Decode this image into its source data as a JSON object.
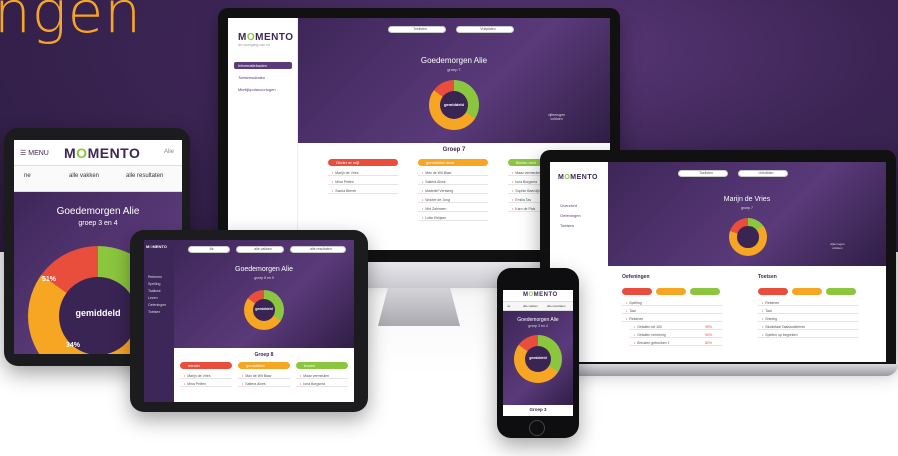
{
  "headline": "ngen",
  "brand": {
    "name_prefix": "M",
    "name_o": "O",
    "name_suffix": "MENTO",
    "tagline": "de voortgang van nu"
  },
  "imac": {
    "search_pills": [
      "Toelisten",
      "Vuitplaten"
    ],
    "sidebar": [
      "Informatiebaden",
      "Toetsresultaten",
      "Mietiijkpotacoorlogen"
    ],
    "greeting": "Goedemorgen Alie",
    "subtitle": "groep 7",
    "donut_label": "gemiddeld",
    "side_note": "vijfenrugen\nvoldoen",
    "group_title": "Groep 7",
    "columns": [
      {
        "header": "Onder er mijf",
        "color": "#e94e3d",
        "rows": [
          "Marijn de Vries",
          "Mina Petten",
          "Sacha Bierek"
        ]
      },
      {
        "header": "gemiddeld deze",
        "color": "#f6a623",
        "rows": [
          "Max de Wit Blaw",
          "Saltera Alves",
          "Madelief Versteeg",
          "Wouter de Jong",
          "Mirt Zahirwen",
          "Lotte Kleijsen"
        ]
      },
      {
        "header": "Boven veld",
        "color": "#8cc63f",
        "rows": [
          "Maaz vermeulen",
          "Iona Borgsma",
          "Sophie Baerdijk",
          "Emilia Tas",
          "Karo de Pals"
        ]
      }
    ]
  },
  "tablet_left": {
    "menu": "MENU",
    "user": "Alie",
    "tabs": [
      "ne",
      "alle vakken",
      "alle resultaten"
    ],
    "greeting": "Goedemorgen Alie",
    "subtitle": "groep 3 en 4",
    "pct_top": "51%",
    "donut_label": "gemiddeld",
    "pct_bottom": "34%"
  },
  "tablet_center": {
    "pills": [
      "Mr.",
      "alle vakken",
      "alle resultaten"
    ],
    "sidebar": [
      "Rekenen",
      "Spelling",
      "Taalkwe",
      "Lezen",
      "Oefeningen",
      "Toetsen"
    ],
    "greeting": "Goedemorgen Alie",
    "subtitle": "groep 8 en 9",
    "donut_label": "gemiddeld",
    "group_title": "Groep 8",
    "columns": [
      {
        "header": "minder",
        "color": "#e94e3d",
        "rows": [
          "Marijn de Vries",
          "Mina Petten"
        ]
      },
      {
        "header": "gemiddeld",
        "color": "#f6a623",
        "rows": [
          "Max de Wit Blaw",
          "Saltera Alves"
        ]
      },
      {
        "header": "boven",
        "color": "#8cc63f",
        "rows": [
          "Maaz vermeulen",
          "Iona Borgsma"
        ]
      }
    ]
  },
  "laptop": {
    "pills": [
      "Toelisten",
      "Uitroltden"
    ],
    "sidebar": [
      "Overzicht",
      "Oefeningen",
      "Toetsen"
    ],
    "student": "Marijn de Vries",
    "subtitle": "groep 7",
    "side_note": "vijfenrugen\nvoldoen",
    "section_left": "Oefeningen",
    "section_right": "Toetsen",
    "left_rows": [
      "Spelling",
      "Taal",
      "Rekenen"
    ],
    "sub_rows": [
      {
        "label": "Getallen tot 100",
        "score": "95%"
      },
      {
        "label": "Getallen vermenig",
        "score": "90%"
      },
      {
        "label": "Breuken gebruiken 1",
        "score": "82%"
      }
    ],
    "right_rows": [
      "Rekenen",
      "Taal",
      "Sheelig",
      "Studietaal Taalstudieleren",
      "Spellen op begreben"
    ]
  },
  "phone": {
    "logo_text": "MOMENTO",
    "nav": [
      "ne",
      "alle vakken",
      "alle resultaten"
    ],
    "greeting": "Goedemorgen Alie",
    "subtitle": "groep 3 en 4",
    "donut_label": "gemiddeld",
    "group_title": "Groep 3"
  },
  "colors": {
    "red": "#e94e3d",
    "orange": "#f6a623",
    "green": "#8cc63f",
    "purple": "#3d2658",
    "headline": "#f6a623"
  }
}
